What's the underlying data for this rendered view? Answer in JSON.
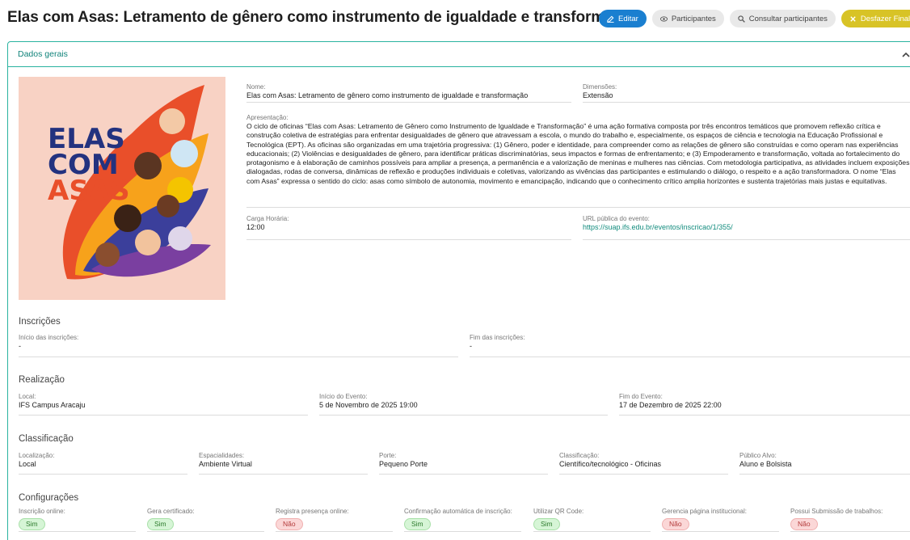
{
  "page": {
    "title": "Elas com Asas: Letramento de gênero como instrumento de igualdade e transformação"
  },
  "actions": {
    "edit": "Editar",
    "participants": "Participantes",
    "consult": "Consultar participantes",
    "undo": "Desfazer Finalização"
  },
  "panel": {
    "title": "Dados gerais"
  },
  "image": {
    "logo_text": [
      "ELAS",
      "COM",
      "ASAS"
    ]
  },
  "details": {
    "nome_label": "Nome:",
    "nome_value": "Elas com Asas: Letramento de gênero como instrumento de igualdade e transformação",
    "dimensoes_label": "Dimensões:",
    "dimensoes_value": "Extensão",
    "apresentacao_label": "Apresentação:",
    "apresentacao_value": "O ciclo de oficinas “Elas com Asas: Letramento de Gênero como Instrumento de Igualdade e Transformação” é uma ação formativa composta por três encontros temáticos que promovem reflexão crítica e construção coletiva de estratégias para enfrentar desigualdades de gênero que atravessam a escola, o mundo do trabalho e, especialmente, os espaços de ciência e tecnologia na Educação Profissional e Tecnológica (EPT). As oficinas são organizadas em uma trajetória progressiva: (1) Gênero, poder e identidade, para compreender como as relações de gênero são construídas e como operam nas experiências educacionais; (2) Violências e desigualdades de gênero, para identificar práticas discriminatórias, seus impactos e formas de enfrentamento; e (3) Empoderamento e transformação, voltada ao fortalecimento do protagonismo e à elaboração de caminhos possíveis para ampliar a presença, a permanência e a valorização de meninas e mulheres nas ciências. Com metodologia participativa, as atividades incluem exposições dialogadas, rodas de conversa, dinâmicas de reflexão e produções individuais e coletivas, valorizando as vivências das participantes e estimulando o diálogo, o respeito e a ação transformadora. O nome “Elas com Asas” expressa o sentido do ciclo: asas como símbolo de autonomia, movimento e emancipação, indicando que o conhecimento crítico amplia horizontes e sustenta trajetórias mais justas e equitativas.",
    "carga_label": "Carga Horária:",
    "carga_value": "12:00",
    "url_label": "URL pública do evento:",
    "url_value": "https://suap.ifs.edu.br/eventos/inscricao/1/355/"
  },
  "inscricoes": {
    "title": "Inscrições",
    "inicio_label": "Início das inscrições:",
    "inicio_value": "-",
    "fim_label": "Fim das inscrições:",
    "fim_value": "-"
  },
  "realizacao": {
    "title": "Realização",
    "local_label": "Local:",
    "local_value": "IFS Campus Aracaju",
    "inicio_label": "Início do Evento:",
    "inicio_value": "5 de Novembro de 2025 19:00",
    "fim_label": "Fim do Evento:",
    "fim_value": "17 de Dezembro de 2025 22:00"
  },
  "classificacao": {
    "title": "Classificação",
    "localizacao_label": "Localização:",
    "localizacao_value": "Local",
    "especialidades_label": "Espacialidades:",
    "especialidades_value": "Ambiente Virtual",
    "porte_label": "Porte:",
    "porte_value": "Pequeno Porte",
    "classificacao_label": "Classificação:",
    "classificacao_value": "Científico/tecnológico - Oficinas",
    "publico_label": "Público Alvo:",
    "publico_value": "Aluno e Bolsista"
  },
  "configuracoes": {
    "title": "Configurações",
    "items": [
      {
        "label": "Inscrição online:",
        "value": "Sim"
      },
      {
        "label": "Gera certificado:",
        "value": "Sim"
      },
      {
        "label": "Registra presença online:",
        "value": "Não"
      },
      {
        "label": "Confirmação automática de inscrição:",
        "value": "Sim"
      },
      {
        "label": "Utilizar QR Code:",
        "value": "Sim"
      },
      {
        "label": "Gerencia página institucional:",
        "value": "Não"
      },
      {
        "label": "Possui Submissão de trabalhos:",
        "value": "Não"
      }
    ]
  },
  "colors": {
    "accent": "#2ab3a0",
    "primary_button": "#1a7fd0",
    "warning_button": "#d8c326"
  },
  "icons": [
    "edit-icon",
    "eye-icon",
    "search-icon",
    "close-icon",
    "chevron-up-icon"
  ]
}
